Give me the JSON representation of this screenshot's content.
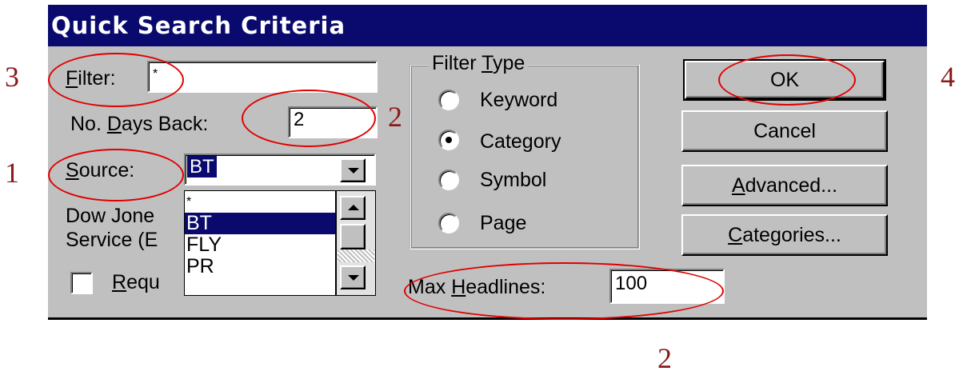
{
  "dialog": {
    "title": "Quick Search Criteria",
    "filter_label_first": "F",
    "filter_label_rest": "ilter:",
    "filter_value": "*",
    "days_label_pre": "No. ",
    "days_label_ul": "D",
    "days_label_post": "ays Back:",
    "days_value": "2",
    "source_label_ul": "S",
    "source_label_rest": "ource:",
    "source_value": "BT",
    "source_desc_line1": "Dow Jone",
    "source_desc_line2": "Service (E",
    "source_options": [
      "*",
      "BT",
      "FLY",
      "PR"
    ],
    "source_selected_index": 1,
    "requ_label_ul": "R",
    "requ_label_rest": "equ",
    "filter_type": {
      "title_pre": "Filter ",
      "title_ul": "T",
      "title_post": "ype",
      "options": [
        "Keyword",
        "Category",
        "Symbol",
        "Page"
      ],
      "selected": "Category"
    },
    "max_headlines_pre": "Max ",
    "max_headlines_ul": "H",
    "max_headlines_post": "eadlines:",
    "max_headlines_value": "100",
    "buttons": {
      "ok": "OK",
      "cancel": "Cancel",
      "advanced_ul": "A",
      "advanced_rest": "dvanced...",
      "categories_ul": "C",
      "categories_rest": "ategories..."
    }
  },
  "annotations": {
    "n1": "1",
    "n2a": "2",
    "n2b": "2",
    "n3": "3",
    "n4": "4"
  },
  "colors": {
    "title_bar": "#0a0a6e",
    "dialog_face": "#c0c0c0",
    "annotation_ellipse": "#e00000",
    "annotation_number": "#8b1a1a"
  }
}
